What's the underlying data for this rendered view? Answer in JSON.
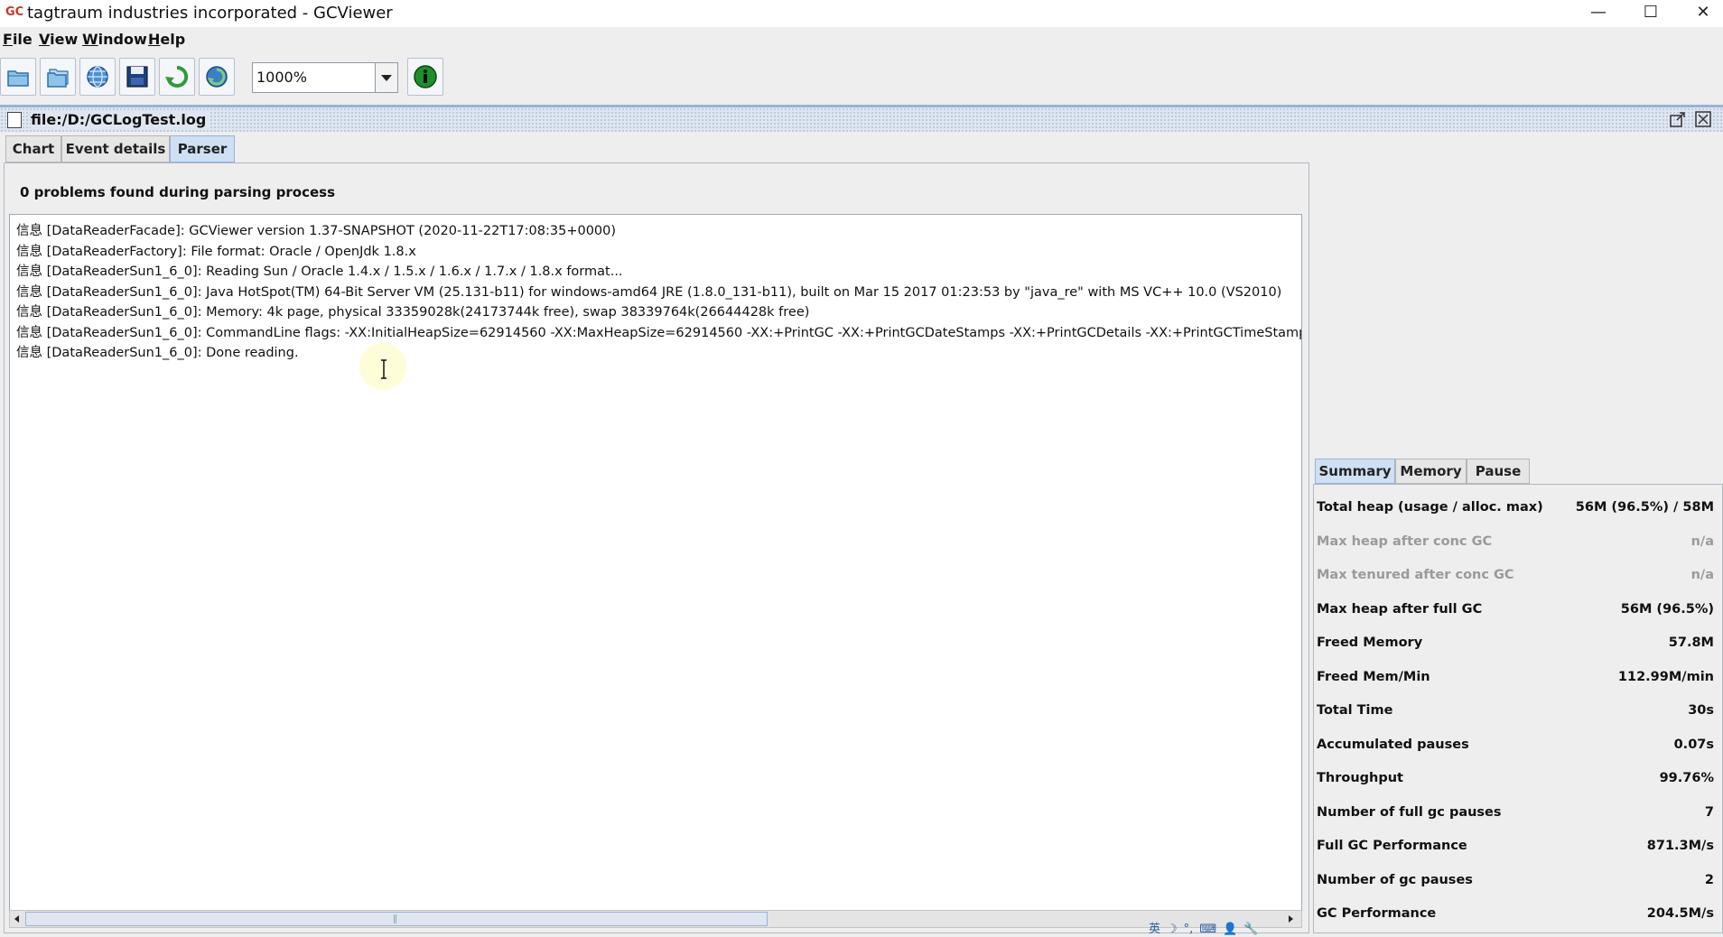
{
  "window": {
    "title": "tagtraum industries incorporated - GCViewer",
    "app_icon": "GC",
    "controls": {
      "minimize": "—",
      "maximize": "☐",
      "close": "✕"
    }
  },
  "menubar": {
    "items": [
      {
        "key": "F",
        "rest": "ile"
      },
      {
        "key": "V",
        "rest": "iew"
      },
      {
        "key": "W",
        "rest": "indow"
      },
      {
        "key": "H",
        "rest": "elp"
      }
    ]
  },
  "toolbar": {
    "buttons": [
      "open-file-icon",
      "open-series-icon",
      "open-url-icon",
      "export-icon",
      "refresh-icon",
      "watch-icon",
      "about-icon"
    ],
    "zoom_value": "1000%"
  },
  "frame": {
    "title": "file:/D:/GCLogTest.log"
  },
  "tabs": [
    "Chart",
    "Event details",
    "Parser"
  ],
  "parser": {
    "problems_text": "0 problems found during parsing process",
    "log_lines": [
      "信息 [DataReaderFacade]: GCViewer version 1.37-SNAPSHOT (2020-11-22T17:08:35+0000)",
      "信息 [DataReaderFactory]: File format: Oracle / OpenJdk 1.8.x",
      "信息 [DataReaderSun1_6_0]: Reading Sun / Oracle 1.4.x / 1.5.x / 1.6.x / 1.7.x / 1.8.x format...",
      "信息 [DataReaderSun1_6_0]: Java HotSpot(TM) 64-Bit Server VM (25.131-b11) for windows-amd64 JRE (1.8.0_131-b11), built on Mar 15 2017 01:23:53 by \"java_re\" with MS VC++ 10.0 (VS2010)",
      "信息 [DataReaderSun1_6_0]: Memory: 4k page, physical 33359028k(24173744k free), swap 38339764k(26644428k free)",
      "信息 [DataReaderSun1_6_0]: CommandLine flags: -XX:InitialHeapSize=62914560 -XX:MaxHeapSize=62914560 -XX:+PrintGC -XX:+PrintGCDateStamps -XX:+PrintGCDetails -XX:+PrintGCTimeStamps -XX:+PrintHeapAtGC",
      "信息 [DataReaderSun1_6_0]: Done reading."
    ]
  },
  "summary_tabs": [
    "Summary",
    "Memory",
    "Pause"
  ],
  "summary": {
    "rows": [
      {
        "label": "Total heap (usage / alloc. max)",
        "value": "56M (96.5%) / 58M"
      },
      {
        "label": "Max heap after conc GC",
        "value": "n/a"
      },
      {
        "label": "Max tenured after conc GC",
        "value": "n/a"
      },
      {
        "label": "Max heap after full GC",
        "value": "56M (96.5%)"
      },
      {
        "label": "Freed Memory",
        "value": "57.8M"
      },
      {
        "label": "Freed Mem/Min",
        "value": "112.99M/min"
      },
      {
        "label": "Total Time",
        "value": "30s"
      },
      {
        "label": "Accumulated pauses",
        "value": "0.07s"
      },
      {
        "label": "Throughput",
        "value": "99.76%"
      },
      {
        "label": "Number of full gc pauses",
        "value": "7"
      },
      {
        "label": "Full GC Performance",
        "value": "871.3M/s"
      },
      {
        "label": "Number of gc pauses",
        "value": "2"
      },
      {
        "label": "GC Performance",
        "value": "204.5M/s"
      }
    ]
  },
  "ime_tray": [
    "英",
    "☽",
    "°,",
    "⌨",
    "👤",
    "🔧"
  ]
}
